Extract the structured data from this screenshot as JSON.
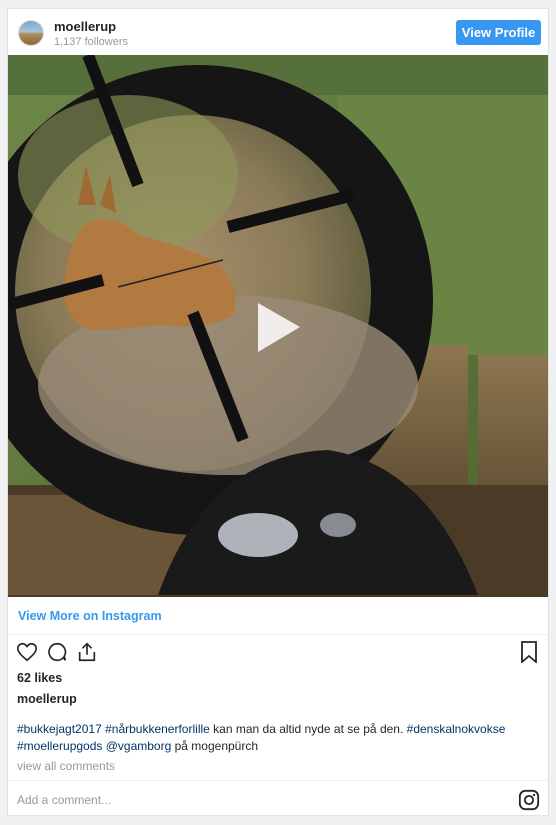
{
  "header": {
    "username": "moellerup",
    "followers": "1,137 followers",
    "view_profile": "View Profile"
  },
  "media": {
    "type": "video",
    "play_icon": "play-icon"
  },
  "view_more": "View More on Instagram",
  "actions": {
    "icons": [
      "heart-icon",
      "comment-icon",
      "share-icon"
    ],
    "bookmark_icon": "bookmark-icon"
  },
  "likes": "62 likes",
  "author": "moellerup",
  "caption": {
    "part1": "#bukkejagt2017",
    "part2": " ",
    "part3": "#nårbukkenerforlille",
    "part4": " kan man da altid nyde at se på den. ",
    "part5": "#denskalnokvokse",
    "part6": "#moellerupgods",
    "part7": " ",
    "part8": "@vgamborg",
    "part9": " på mogenpürch"
  },
  "view_comments": "view all comments",
  "add_comment_placeholder": "Add a comment...",
  "colors": {
    "accent": "#3897f0",
    "hashtag": "#003569",
    "muted": "#999999"
  }
}
